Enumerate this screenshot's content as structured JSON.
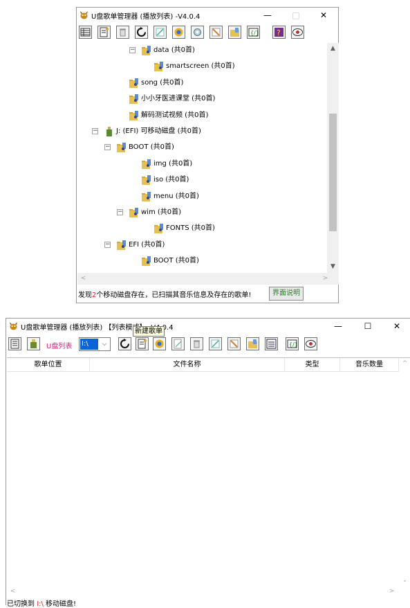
{
  "colors": {
    "accent": "#0a64d6",
    "status_red": "#e02020",
    "pink_label": "#e0207a",
    "green_text": "#2a7a2a"
  },
  "window1": {
    "title": "U盘歌单管理器 (播放列表)  -V4.0.4",
    "controls": {
      "minimize": "—",
      "maximize": "□",
      "close": "✕"
    },
    "toolbar_icons": [
      "grid-icon",
      "playlist-icon",
      "trash-icon",
      "refresh-icon",
      "edit-icon",
      "scan-icon",
      "settings-icon",
      "pencil-icon",
      "music-folder-icon",
      "code-icon",
      "help-icon",
      "eye-icon"
    ],
    "tree": [
      {
        "label": "data  (共0首)",
        "expander": "⊟"
      },
      {
        "label": "smartscreen  (共0首)"
      },
      {
        "label": "song  (共0首)"
      },
      {
        "label": "小小牙医进课堂  (共0首)"
      },
      {
        "label": "解码测试视频  (共0首)"
      },
      {
        "label": "J: (EFI) 可移动磁盘  (共0首)",
        "expander": "⊟",
        "drive": true
      },
      {
        "label": "BOOT  (共0首)",
        "expander": "⊟"
      },
      {
        "label": "img  (共0首)"
      },
      {
        "label": "iso  (共0首)"
      },
      {
        "label": "menu  (共0首)"
      },
      {
        "label": "wim  (共0首)",
        "expander": "⊟"
      },
      {
        "label": "FONTS  (共0首)"
      },
      {
        "label": "EFI  (共0首)",
        "expander": "⊟"
      },
      {
        "label": "BOOT  (共0首)"
      }
    ],
    "status": {
      "prefix": "发现",
      "count": "2",
      "suffix": "个移动磁盘存在，已扫描其音乐信息及存在的歌单!"
    },
    "help_button": "界面说明"
  },
  "window2": {
    "title": "U盘歌单管理器 (播放列表) 【列表模式】 -V4.0.4",
    "controls": {
      "minimize": "—",
      "maximize": "☐",
      "close": "✕"
    },
    "u_list_label": "U盘列表",
    "drive_value": "I:\\",
    "tooltip": "新建歌单",
    "columns": [
      "歌单位置",
      "文件名称",
      "类型",
      "音乐数量"
    ],
    "status": {
      "prefix": "已切换到 ",
      "drive": "I:\\",
      "suffix": " 移动磁盘!"
    }
  }
}
